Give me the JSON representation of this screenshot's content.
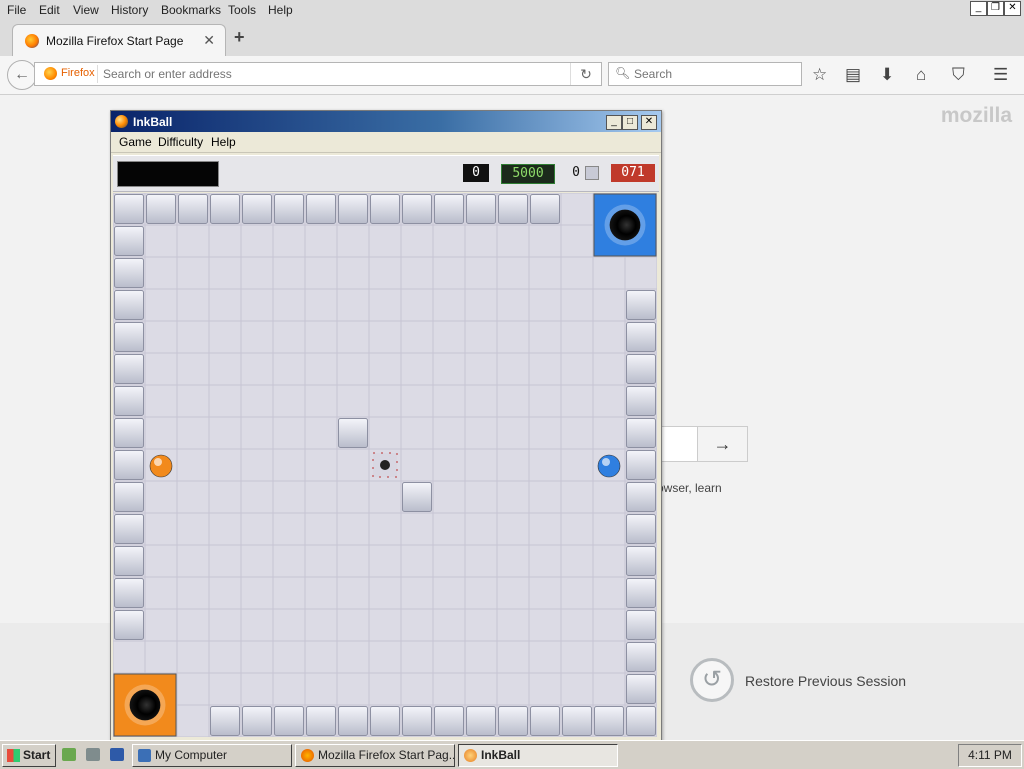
{
  "firefox": {
    "menu": [
      "File",
      "Edit",
      "View",
      "History",
      "Bookmarks",
      "Tools",
      "Help"
    ],
    "tab_title": "Mozilla Firefox Start Page",
    "identity_label": "Firefox",
    "address_placeholder": "Search or enter address",
    "search_placeholder": "Search",
    "page": {
      "logo_text": "mozilla",
      "learn_text": "owser, learn",
      "restore_session_label": "Restore Previous Session"
    }
  },
  "inkball": {
    "title": "InkBall",
    "menu": [
      "Game",
      "Difficulty",
      "Help"
    ],
    "score": "0",
    "potential": "5000",
    "balls_remaining": "0",
    "timer": "071",
    "grid_size": 17,
    "wall_cells": [
      [
        0,
        0
      ],
      [
        1,
        0
      ],
      [
        2,
        0
      ],
      [
        3,
        0
      ],
      [
        4,
        0
      ],
      [
        5,
        0
      ],
      [
        6,
        0
      ],
      [
        7,
        0
      ],
      [
        8,
        0
      ],
      [
        9,
        0
      ],
      [
        10,
        0
      ],
      [
        11,
        0
      ],
      [
        12,
        0
      ],
      [
        13,
        0
      ],
      [
        0,
        1
      ],
      [
        0,
        2
      ],
      [
        0,
        3
      ],
      [
        0,
        4
      ],
      [
        0,
        5
      ],
      [
        0,
        6
      ],
      [
        0,
        7
      ],
      [
        0,
        8
      ],
      [
        0,
        9
      ],
      [
        0,
        10
      ],
      [
        0,
        11
      ],
      [
        0,
        12
      ],
      [
        0,
        13
      ],
      [
        16,
        3
      ],
      [
        16,
        4
      ],
      [
        16,
        5
      ],
      [
        16,
        6
      ],
      [
        16,
        7
      ],
      [
        16,
        8
      ],
      [
        16,
        9
      ],
      [
        16,
        10
      ],
      [
        16,
        11
      ],
      [
        16,
        12
      ],
      [
        16,
        13
      ],
      [
        16,
        14
      ],
      [
        16,
        15
      ],
      [
        16,
        16
      ],
      [
        3,
        16
      ],
      [
        4,
        16
      ],
      [
        5,
        16
      ],
      [
        6,
        16
      ],
      [
        7,
        16
      ],
      [
        8,
        16
      ],
      [
        9,
        16
      ],
      [
        10,
        16
      ],
      [
        11,
        16
      ],
      [
        12,
        16
      ],
      [
        13,
        16
      ],
      [
        14,
        16
      ],
      [
        15,
        16
      ],
      [
        7,
        7
      ],
      [
        9,
        9
      ]
    ],
    "holes": [
      {
        "color": "blue",
        "cells": [
          15,
          0
        ],
        "span": 2
      },
      {
        "color": "orange",
        "cells": [
          0,
          15
        ],
        "span": 2
      }
    ],
    "spawner_cell": [
      8,
      8
    ],
    "balls": [
      {
        "color": "orange",
        "cell": [
          1,
          8
        ]
      },
      {
        "color": "blue",
        "cell": [
          15,
          8
        ]
      }
    ],
    "colors": {
      "blue": "#2f7fe0",
      "orange": "#f28a1c",
      "board": "#dcdbe5",
      "wall": "#c9cbd8"
    }
  },
  "taskbar": {
    "start_label": "Start",
    "buttons": [
      "My Computer",
      "Mozilla Firefox Start Pag...",
      "InkBall"
    ],
    "clock": "4:11 PM"
  }
}
